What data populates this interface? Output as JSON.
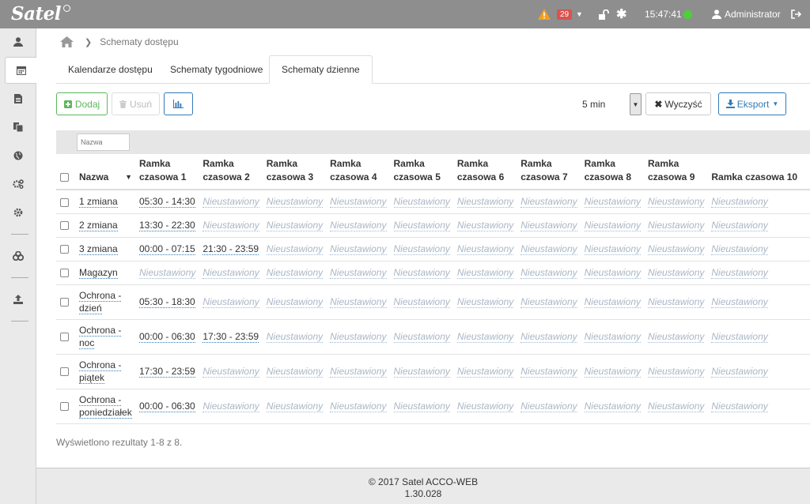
{
  "brand": {
    "logo_text": "Satel"
  },
  "topbar": {
    "alert_count": "29",
    "clock": "15:47:41",
    "user_name": "Administrator",
    "status_color": "#4cd137"
  },
  "breadcrumb": {
    "current": "Schematy dostępu"
  },
  "tabs": [
    {
      "label": "Kalendarze dostępu"
    },
    {
      "label": "Schematy tygodniowe"
    },
    {
      "label": "Schematy dzienne"
    }
  ],
  "toolbar": {
    "add_label": "Dodaj",
    "delete_label": "Usuń",
    "interval_value": "5 min",
    "clear_label": "Wyczyść",
    "export_label": "Eksport"
  },
  "filter": {
    "name_placeholder": "Nazwa"
  },
  "table": {
    "headers": [
      "Nazwa",
      "Ramka czasowa 1",
      "Ramka czasowa 2",
      "Ramka czasowa 3",
      "Ramka czasowa 4",
      "Ramka czasowa 5",
      "Ramka czasowa 6",
      "Ramka czasowa 7",
      "Ramka czasowa 8",
      "Ramka czasowa 9",
      "Ramka czasowa 10"
    ],
    "rows": [
      {
        "name": "1 zmiana",
        "frames": [
          "05:30 - 14:30",
          "Nieustawiony",
          "Nieustawiony",
          "Nieustawiony",
          "Nieustawiony",
          "Nieustawiony",
          "Nieustawiony",
          "Nieustawiony",
          "Nieustawiony",
          "Nieustawiony"
        ]
      },
      {
        "name": "2 zmiana",
        "frames": [
          "13:30 - 22:30",
          "Nieustawiony",
          "Nieustawiony",
          "Nieustawiony",
          "Nieustawiony",
          "Nieustawiony",
          "Nieustawiony",
          "Nieustawiony",
          "Nieustawiony",
          "Nieustawiony"
        ]
      },
      {
        "name": "3 zmiana",
        "frames": [
          "00:00 - 07:15",
          "21:30 - 23:59",
          "Nieustawiony",
          "Nieustawiony",
          "Nieustawiony",
          "Nieustawiony",
          "Nieustawiony",
          "Nieustawiony",
          "Nieustawiony",
          "Nieustawiony"
        ]
      },
      {
        "name": "Magazyn",
        "frames": [
          "Nieustawiony",
          "Nieustawiony",
          "Nieustawiony",
          "Nieustawiony",
          "Nieustawiony",
          "Nieustawiony",
          "Nieustawiony",
          "Nieustawiony",
          "Nieustawiony",
          "Nieustawiony"
        ]
      },
      {
        "name": "Ochrona - dzień",
        "frames": [
          "05:30 - 18:30",
          "Nieustawiony",
          "Nieustawiony",
          "Nieustawiony",
          "Nieustawiony",
          "Nieustawiony",
          "Nieustawiony",
          "Nieustawiony",
          "Nieustawiony",
          "Nieustawiony"
        ]
      },
      {
        "name": "Ochrona - noc",
        "frames": [
          "00:00 - 06:30",
          "17:30 - 23:59",
          "Nieustawiony",
          "Nieustawiony",
          "Nieustawiony",
          "Nieustawiony",
          "Nieustawiony",
          "Nieustawiony",
          "Nieustawiony",
          "Nieustawiony"
        ]
      },
      {
        "name": "Ochrona - piątek",
        "frames": [
          "17:30 - 23:59",
          "Nieustawiony",
          "Nieustawiony",
          "Nieustawiony",
          "Nieustawiony",
          "Nieustawiony",
          "Nieustawiony",
          "Nieustawiony",
          "Nieustawiony",
          "Nieustawiony"
        ]
      },
      {
        "name": "Ochrona - poniedziałek",
        "frames": [
          "00:00 - 06:30",
          "Nieustawiony",
          "Nieustawiony",
          "Nieustawiony",
          "Nieustawiony",
          "Nieustawiony",
          "Nieustawiony",
          "Nieustawiony",
          "Nieustawiony",
          "Nieustawiony"
        ]
      }
    ]
  },
  "results_text": "Wyświetlono rezultaty 1-8 z 8.",
  "footer": {
    "copyright": "© 2017 Satel ACCO-WEB",
    "version": "1.30.028"
  },
  "colors": {
    "topbar": "#8e8e8e",
    "add_green": "#5cb85c",
    "primary_blue": "#337ab7",
    "badge_red": "#d9534f",
    "warning_orange": "#f0a020"
  }
}
